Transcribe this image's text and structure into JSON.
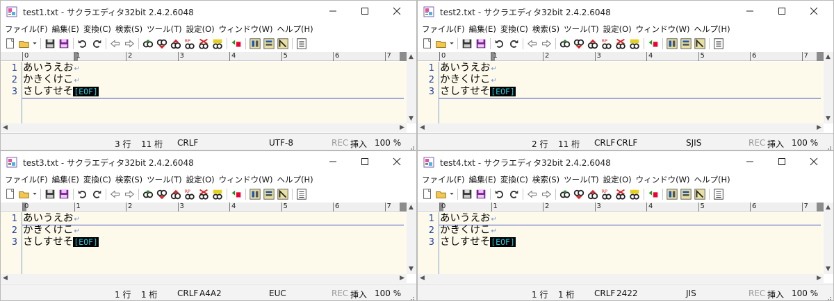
{
  "app": {
    "icon": "sakura-editor-icon",
    "menu": [
      "ファイル(F)",
      "編集(E)",
      "変換(C)",
      "検索(S)",
      "ツール(T)",
      "設定(O)",
      "ウィンドウ(W)",
      "ヘルプ(H)"
    ],
    "ruler": [
      "0",
      "1",
      "2",
      "3",
      "4",
      "5",
      "6",
      "7"
    ],
    "eof": "[EOF]",
    "colors": {
      "editor_bg": "#fefaeb",
      "line_number": "#1d3fa8",
      "eof_fg": "#1ed2e8",
      "eof_bg": "#000000",
      "crlf": "#6f93d8"
    }
  },
  "windows": [
    {
      "title": "test1.txt - サクラエディタ32bit 2.4.2.6048",
      "lines": [
        {
          "num": "1",
          "text": "あいうえお",
          "crlf": "↵"
        },
        {
          "num": "2",
          "text": "かきくけこ",
          "crlf": "↵"
        },
        {
          "num": "3",
          "text": "さしすせそ",
          "crlf": ""
        }
      ],
      "caret_line": 3,
      "status": {
        "row": "3 行",
        "col": "11 桁",
        "eol": "CRLF",
        "code": "",
        "encoding": "UTF-8",
        "rec": "REC",
        "mode": "挿入",
        "zoom": "100 %"
      }
    },
    {
      "title": "test2.txt - サクラエディタ32bit 2.4.2.6048",
      "lines": [
        {
          "num": "1",
          "text": "あいうえお",
          "crlf": "↵"
        },
        {
          "num": "2",
          "text": "かきくけこ",
          "crlf": "↵"
        },
        {
          "num": "3",
          "text": "さしすせそ",
          "crlf": ""
        }
      ],
      "caret_line": 3,
      "status": {
        "row": "2 行",
        "col": "11 桁",
        "eol": "CRLF",
        "code": "CRLF",
        "encoding": "SJIS",
        "rec": "REC",
        "mode": "挿入",
        "zoom": "100 %"
      }
    },
    {
      "title": "test3.txt - サクラエディタ32bit 2.4.2.6048",
      "lines": [
        {
          "num": "1",
          "text": "あいうえお",
          "crlf": "↵"
        },
        {
          "num": "2",
          "text": "かきくけこ",
          "crlf": "↵"
        },
        {
          "num": "3",
          "text": "さしすせそ",
          "crlf": ""
        }
      ],
      "caret_line": 1,
      "status": {
        "row": "1 行",
        "col": "1 桁",
        "eol": "CRLF",
        "code": "A4A2",
        "encoding": "EUC",
        "rec": "REC",
        "mode": "挿入",
        "zoom": "100 %"
      }
    },
    {
      "title": "test4.txt - サクラエディタ32bit 2.4.2.6048",
      "lines": [
        {
          "num": "1",
          "text": "あいうえお",
          "crlf": "↵"
        },
        {
          "num": "2",
          "text": "かきくけこ",
          "crlf": "↵"
        },
        {
          "num": "3",
          "text": "さしすせそ",
          "crlf": ""
        }
      ],
      "caret_line": 1,
      "status": {
        "row": "1 行",
        "col": "1 桁",
        "eol": "CRLF",
        "code": "2422",
        "encoding": "JIS",
        "rec": "REC",
        "mode": "挿入",
        "zoom": "100 %"
      }
    }
  ]
}
